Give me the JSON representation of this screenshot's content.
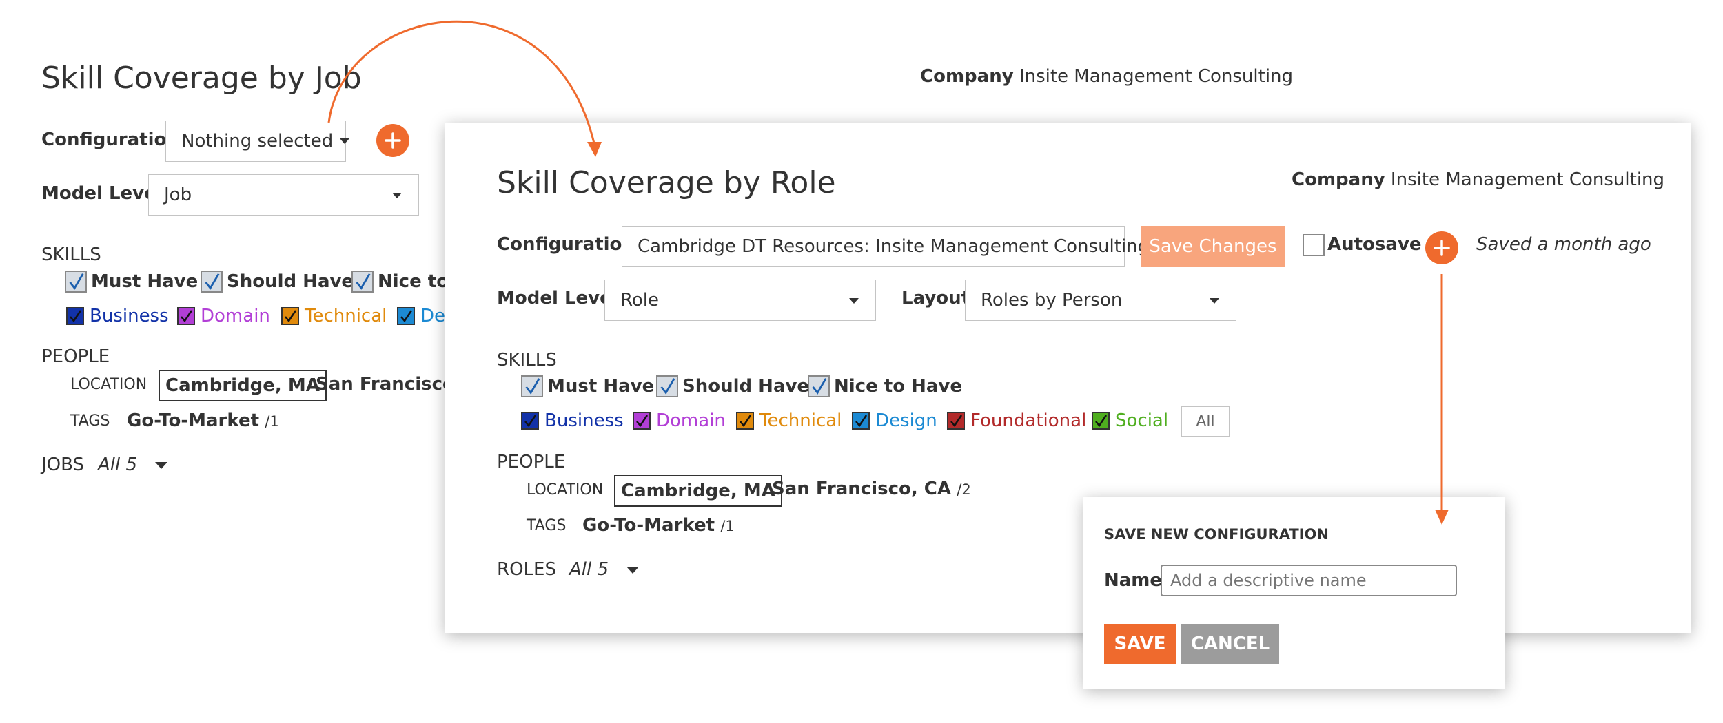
{
  "back": {
    "title": "Skill Coverage by Job",
    "company_label": "Company",
    "company_value": "Insite Management Consulting",
    "config_label": "Configuration",
    "config_value": "Nothing selected",
    "model_level_label": "Model Level",
    "model_level_value": "Job",
    "skills_heading": "SKILLS",
    "priorities": [
      "Must Have",
      "Should Have",
      "Nice to"
    ],
    "categories": [
      {
        "label": "Business",
        "color": "#1232a8"
      },
      {
        "label": "Domain",
        "color": "#b23fd6"
      },
      {
        "label": "Technical",
        "color": "#e08a0c"
      },
      {
        "label": "Des",
        "color": "#1c8ad3"
      }
    ],
    "people_heading": "PEOPLE",
    "location_label": "LOCATION",
    "location_selected": "Cambridge, MA",
    "location_other": "San Francisco, C",
    "tags_label": "TAGS",
    "tag_name": "Go-To-Market",
    "tag_count": "/1",
    "jobs_label": "JOBS",
    "jobs_value": "All 5"
  },
  "front": {
    "title": "Skill Coverage by Role",
    "company_label": "Company",
    "company_value": "Insite Management Consulting",
    "config_label": "Configuration",
    "config_value": "Cambridge DT Resources: Insite Management Consulting",
    "save_changes": "Save Changes",
    "autosave_label": "Autosave",
    "saved_status": "Saved a month ago",
    "model_level_label": "Model Level",
    "model_level_value": "Role",
    "layout_label": "Layout",
    "layout_value": "Roles by Person",
    "skills_heading": "SKILLS",
    "priorities": [
      "Must Have",
      "Should Have",
      "Nice to Have"
    ],
    "categories": [
      {
        "label": "Business",
        "color": "#1232a8"
      },
      {
        "label": "Domain",
        "color": "#b23fd6"
      },
      {
        "label": "Technical",
        "color": "#e08a0c"
      },
      {
        "label": "Design",
        "color": "#1c8ad3"
      },
      {
        "label": "Foundational",
        "color": "#b22a2a"
      },
      {
        "label": "Social",
        "color": "#4fae1f"
      }
    ],
    "all_button": "All",
    "people_heading": "PEOPLE",
    "location_label": "LOCATION",
    "location_selected": "Cambridge, MA",
    "location_other": "San Francisco, CA",
    "location_other_count": "/2",
    "tags_label": "TAGS",
    "tag_name": "Go-To-Market",
    "tag_count": "/1",
    "roles_label": "ROLES",
    "roles_value": "All 5"
  },
  "dialog": {
    "title": "SAVE NEW CONFIGURATION",
    "name_label": "Name",
    "name_placeholder": "Add a descriptive name",
    "save": "SAVE",
    "cancel": "CANCEL"
  },
  "colors": {
    "accent": "#ef6a2d",
    "save_changes_bg": "#f8a57d",
    "cancel_bg": "#9c9c9c"
  }
}
